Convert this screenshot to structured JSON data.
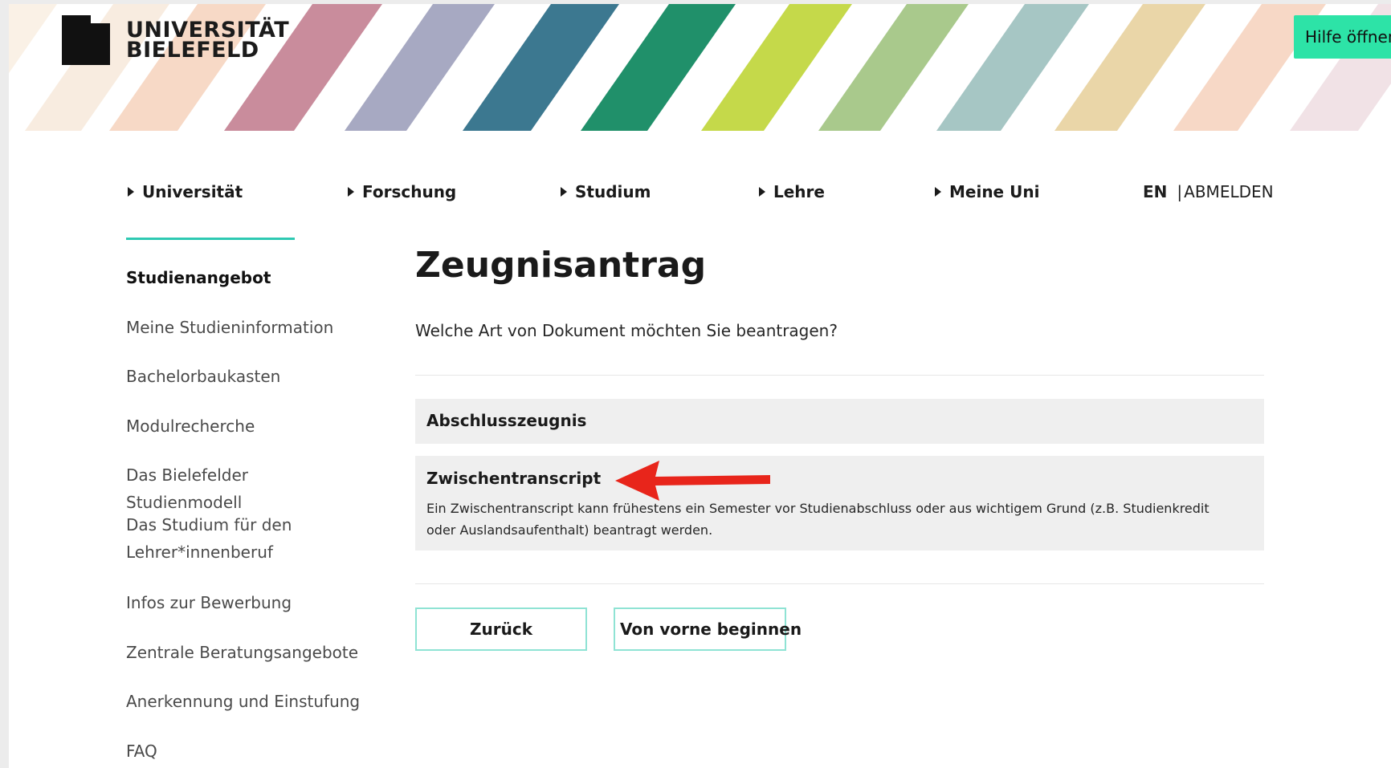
{
  "header": {
    "logo_text": "UNIVERSITÄT\nBIELEFELD",
    "help_button": "Hilfe öffnen"
  },
  "nav": {
    "items": [
      {
        "label": "Universität"
      },
      {
        "label": "Forschung"
      },
      {
        "label": "Studium"
      },
      {
        "label": "Lehre"
      },
      {
        "label": "Meine Uni"
      }
    ],
    "lang": "EN",
    "separator": "|",
    "logout": "ABMELDEN"
  },
  "sidebar": {
    "items": [
      {
        "label": "Studienangebot",
        "active": true
      },
      {
        "label": "Meine Studieninformation"
      },
      {
        "label": "Bachelorbaukasten"
      },
      {
        "label": "Modulrecherche"
      },
      {
        "label": "Das Bielefelder Studienmodell"
      },
      {
        "label": "Das Studium für den Lehrer*innenberuf"
      },
      {
        "label": "Infos zur Bewerbung"
      },
      {
        "label": "Zentrale Beratungsangebote"
      },
      {
        "label": "Anerkennung und Einstufung"
      },
      {
        "label": "FAQ"
      }
    ]
  },
  "main": {
    "title": "Zeugnisantrag",
    "question": "Welche Art von Dokument möchten Sie beantragen?",
    "options": [
      {
        "title": "Abschlusszeugnis"
      },
      {
        "title": "Zwischentranscript",
        "description": "Ein Zwischentranscript kann frühestens ein Semester vor Studienabschluss oder aus wichtigem Grund (z.B. Studienkredit oder Auslandsaufenthalt) beantragt werden."
      }
    ],
    "buttons": {
      "back": "Zurück",
      "restart": "Von vorne beginnen"
    }
  },
  "colors": {
    "accent": "#2ec9b2",
    "help_button": "#2de3a7",
    "option_bg": "#efefef",
    "annotation_arrow": "#e8251b"
  },
  "icons": [
    "logo-mark",
    "nav-triangle-icon",
    "red-arrow-annotation"
  ]
}
